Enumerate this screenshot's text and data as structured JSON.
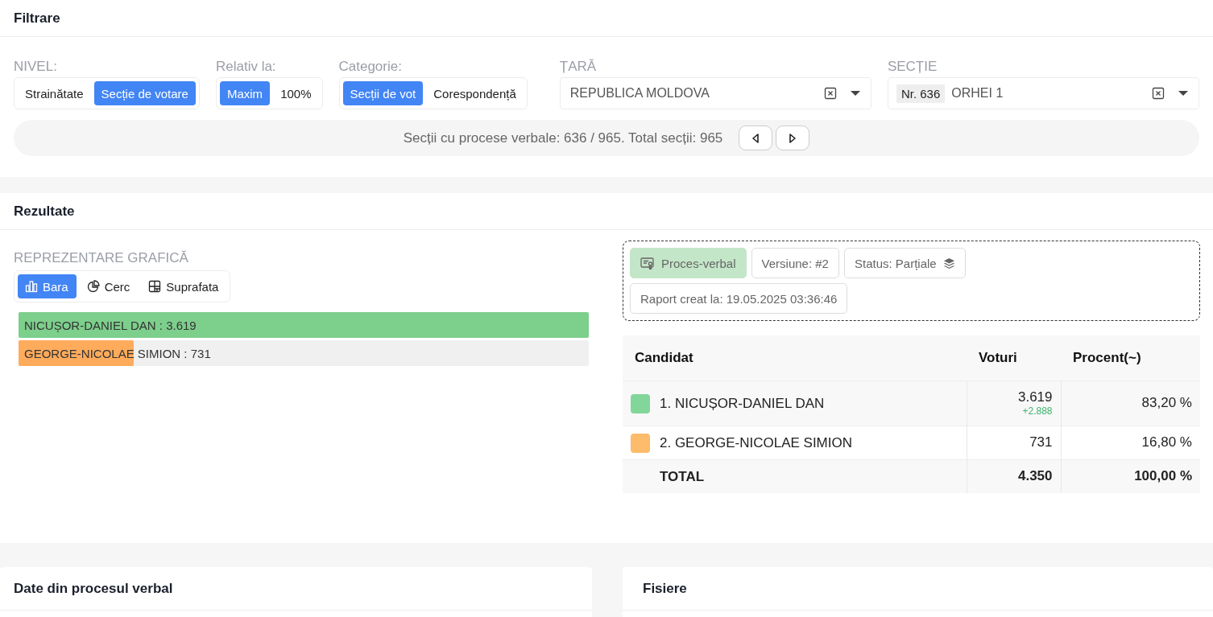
{
  "filters": {
    "title": "Filtrare",
    "groups": [
      {
        "label": "NIVEL:",
        "options": [
          {
            "label": "Strainătate",
            "selected": false
          },
          {
            "label": "Secție de votare",
            "selected": true
          }
        ]
      },
      {
        "label": "Relativ la:",
        "options": [
          {
            "label": "Maxim",
            "selected": true
          },
          {
            "label": "100%",
            "selected": false
          }
        ]
      },
      {
        "label": "Categorie:",
        "options": [
          {
            "label": "Secții de vot",
            "selected": true
          },
          {
            "label": "Corespondență",
            "selected": false
          }
        ]
      }
    ],
    "selects": [
      {
        "label": "ȚARĂ",
        "value": "REPUBLICA MOLDOVA"
      },
      {
        "label": "SECȚIE",
        "tag": "Nr. 636",
        "value": "ORHEI 1"
      }
    ],
    "summary": "Secții cu procese verbale: 636 / 965. Total secții: 965"
  },
  "results": {
    "title": "Rezultate",
    "chart_label": "REPREZENTARE GRAFICĂ",
    "view_tabs": [
      {
        "label": "Bara",
        "kind": "bar",
        "selected": true
      },
      {
        "label": "Cerc",
        "kind": "pie",
        "selected": false
      },
      {
        "label": "Suprafata",
        "kind": "area",
        "selected": false
      }
    ],
    "bars": [
      {
        "label": "NICUȘOR-DANIEL DAN : 3.619",
        "color": "#7dcf8c",
        "level": 1
      },
      {
        "label": "GEORGE-NICOLAE SIMION : 731",
        "color": "#ffab5c",
        "level": 0.202
      }
    ],
    "badges": [
      {
        "kind": "document",
        "text": "Proces-verbal"
      },
      {
        "kind": "plain",
        "text": "Versiune: #2"
      },
      {
        "kind": "status",
        "text": "Status: Parțiale"
      },
      {
        "kind": "plain",
        "text": "Raport creat la: 19.05.2025 03:36:46"
      }
    ],
    "table": {
      "columns": [
        "Candidat",
        "Voturi",
        "Procent(~)"
      ],
      "rows": [
        {
          "color": "#82d699",
          "name": "1. NICUȘOR-DANIEL DAN",
          "votes": "3.619",
          "delta": "+2.888",
          "percent": "83,20 %"
        },
        {
          "color": "#fdbb6c",
          "name": "2. GEORGE-NICOLAE SIMION",
          "votes": "731",
          "percent": "16,80 %"
        }
      ],
      "total": {
        "label": "TOTAL",
        "votes": "4.350",
        "percent": "100,00 %"
      }
    }
  },
  "panels": [
    {
      "title": "Date din procesul verbal"
    },
    {
      "title": "Fisiere"
    }
  ]
}
